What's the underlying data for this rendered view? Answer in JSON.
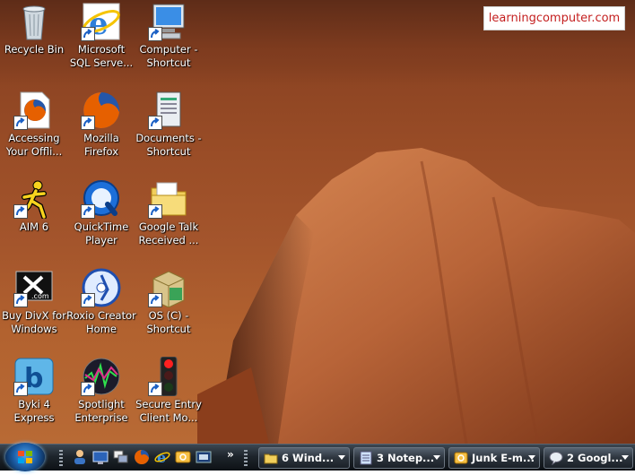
{
  "watermark": "learningcomputer.com",
  "desktop_icons": [
    {
      "name": "recycle-bin",
      "label": "Recycle Bin",
      "icon": "recycle-bin-icon",
      "shortcut": false
    },
    {
      "name": "microsoft-sql-server",
      "label": "Microsoft\nSQL Serve...",
      "icon": "internet-explorer-icon",
      "shortcut": true
    },
    {
      "name": "computer-shortcut",
      "label": "Computer -\nShortcut",
      "icon": "computer-icon",
      "shortcut": true
    },
    {
      "name": "accessing-your-offline",
      "label": "Accessing\nYour Offli...",
      "icon": "firefox-document-icon",
      "shortcut": true
    },
    {
      "name": "mozilla-firefox",
      "label": "Mozilla\nFirefox",
      "icon": "firefox-icon",
      "shortcut": true
    },
    {
      "name": "documents-shortcut",
      "label": "Documents -\nShortcut",
      "icon": "documents-icon",
      "shortcut": true
    },
    {
      "name": "aim-6",
      "label": "AIM 6",
      "icon": "aim-running-man-icon",
      "shortcut": true
    },
    {
      "name": "quicktime-player",
      "label": "QuickTime\nPlayer",
      "icon": "quicktime-icon",
      "shortcut": true
    },
    {
      "name": "google-talk-received",
      "label": "Google Talk\nReceived ...",
      "icon": "folder-icon",
      "shortcut": true
    },
    {
      "name": "buy-divx-for-windows",
      "label": "Buy DivX for\nWindows",
      "icon": "divx-icon",
      "shortcut": true
    },
    {
      "name": "roxio-creator-home",
      "label": "Roxio Creator\nHome",
      "icon": "roxio-disc-icon",
      "shortcut": true
    },
    {
      "name": "os-c-shortcut",
      "label": "OS (C) -\nShortcut",
      "icon": "drive-box-icon",
      "shortcut": true
    },
    {
      "name": "byki-4-express",
      "label": "Byki 4\nExpress",
      "icon": "byki-icon",
      "shortcut": true
    },
    {
      "name": "spotlight-enterprise",
      "label": "Spotlight\nEnterprise",
      "icon": "spotlight-icon",
      "shortcut": true
    },
    {
      "name": "secure-entry-client",
      "label": "Secure Entry\nClient Mo...",
      "icon": "traffic-light-icon",
      "shortcut": true
    }
  ],
  "taskbar": {
    "start_label": "Start",
    "quick_launch": [
      "user-icon",
      "show-desktop-icon",
      "switch-windows-icon",
      "firefox-icon",
      "internet-explorer-icon",
      "mail-icon",
      "screen-icon"
    ],
    "overflow": "»",
    "buttons": [
      {
        "label": "6 Wind...",
        "icon": "folder-icon"
      },
      {
        "label": "3 Notep...",
        "icon": "notepad-icon"
      },
      {
        "label": "Junk E-m...",
        "icon": "outlook-icon"
      },
      {
        "label": "2 Googl...",
        "icon": "google-talk-icon"
      }
    ]
  }
}
